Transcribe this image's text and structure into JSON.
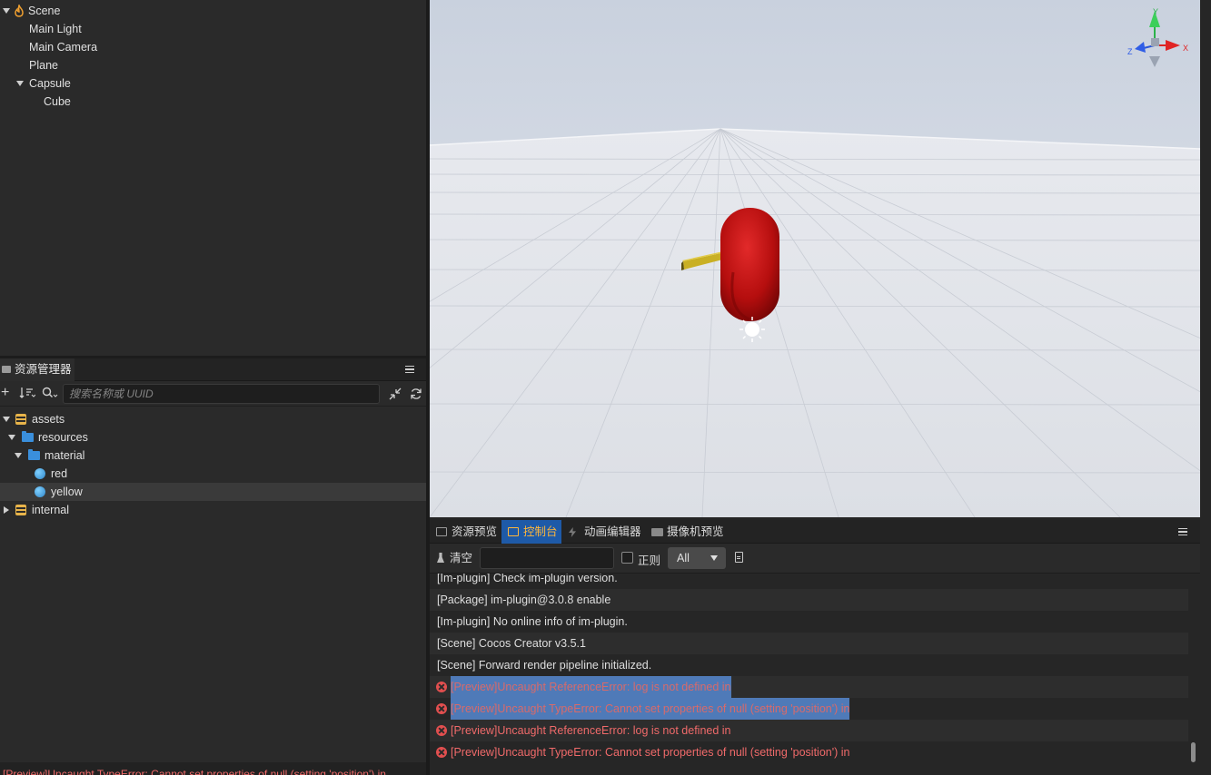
{
  "hierarchy": {
    "root": "Scene",
    "nodes": [
      "Main Light",
      "Main Camera",
      "Plane",
      "Capsule"
    ],
    "child": "Cube"
  },
  "assets_panel": {
    "tab_label": "资源管理器",
    "search_placeholder": "搜索名称或 UUID",
    "tree": {
      "assets": "assets",
      "resources": "resources",
      "material": "material",
      "red": "red",
      "yellow": "yellow",
      "internal": "internal"
    },
    "selected_item": "yellow"
  },
  "status_bar": {
    "text": "[Preview]Uncaught TypeError: Cannot set properties of null (setting 'position') in"
  },
  "gizmo": {
    "x_label": "X",
    "y_label": "Y",
    "z_label": "Z"
  },
  "console_panel": {
    "tabs": [
      "资源预览",
      "控制台",
      "动画编辑器",
      "摄像机预览"
    ],
    "active_tab": "控制台",
    "toolbar": {
      "clear_label": "清空",
      "filter_value": "",
      "regex_label": "正则",
      "regex_checked": false,
      "level_selected": "All"
    },
    "logs": [
      {
        "level": "info",
        "text": "[Im-plugin] Check im-plugin version."
      },
      {
        "level": "info",
        "text": "[Package] im-plugin@3.0.8 enable"
      },
      {
        "level": "info",
        "text": "[Im-plugin] No online info of im-plugin."
      },
      {
        "level": "info",
        "text": "[Scene] Cocos Creator v3.5.1"
      },
      {
        "level": "info",
        "text": "[Scene] Forward render pipeline initialized."
      },
      {
        "level": "error",
        "text": "[Preview]Uncaught ReferenceError: log is not defined in",
        "selected": true
      },
      {
        "level": "error",
        "text": "[Preview]Uncaught TypeError: Cannot set properties of null (setting 'position') in",
        "selected": true
      },
      {
        "level": "error",
        "text": "[Preview]Uncaught ReferenceError: log is not defined in"
      },
      {
        "level": "error",
        "text": "[Preview]Uncaught TypeError: Cannot set properties of null (setting 'position') in"
      }
    ]
  },
  "colors": {
    "active_tab_bg": "#1e5aa8",
    "active_tab_text": "#ffb63b",
    "error_text": "#f06a6a",
    "capsule": "#b00d0d",
    "cube": "#c9b024",
    "asset_root_icon": "#e8b44a",
    "folder_icon": "#3a8fdc"
  }
}
